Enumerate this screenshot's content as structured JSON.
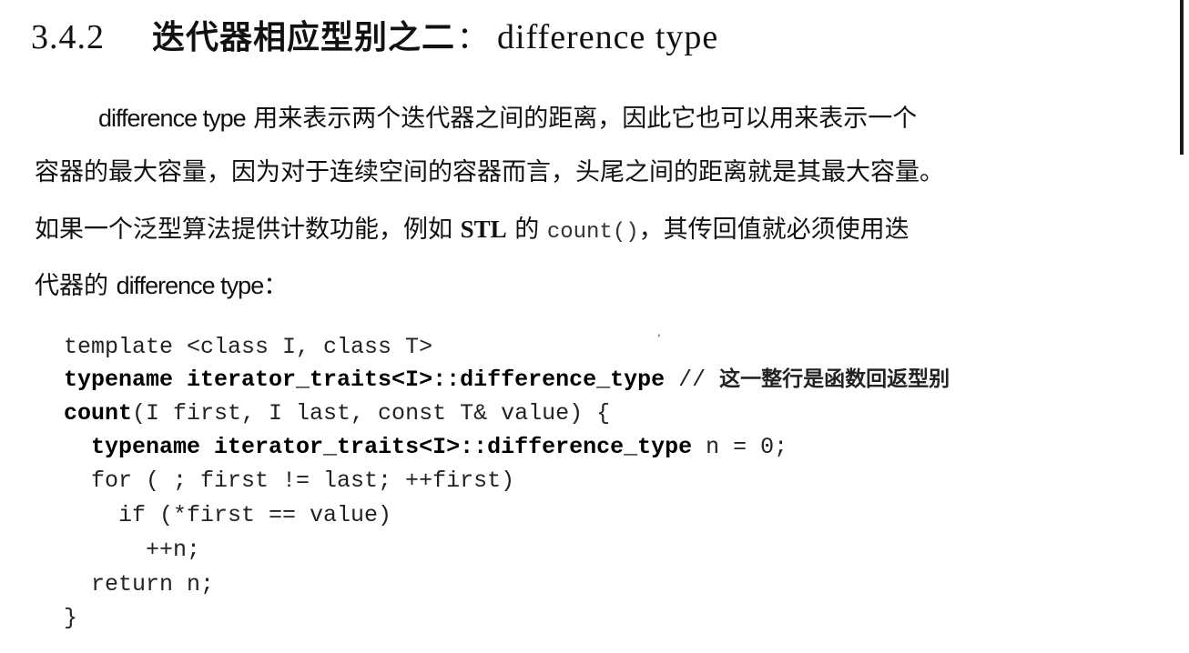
{
  "section": {
    "number": "3.4.2",
    "title_cn": "迭代器相应型别之二",
    "separator": "：",
    "title_en": "difference type"
  },
  "paragraph": {
    "line1": {
      "en_term": "difference type",
      "text": " 用来表示两个迭代器之间的距离，因此它也可以用来表示一个"
    },
    "line2": "容器的最大容量，因为对于连续空间的容器而言，头尾之间的距离就是其最大容量。",
    "line3": {
      "part1": "如果一个泛型算法提供计数功能，例如 ",
      "stl": "STL",
      "part2": " 的 ",
      "code": "count()",
      "part3": "，其传回值就必须使用迭"
    },
    "line4": {
      "part1": "代器的 ",
      "en_term": "difference type",
      "part2": "："
    }
  },
  "code": {
    "line1": "template <class I, class T>",
    "line2_kw": "typename iterator_traits<I>::difference_type",
    "line2_comment": " // ",
    "line2_comment_cn": "这一整行是函数回返型别",
    "line3_kw": "count",
    "line3_rest": "(I first, I last, const T& value) {",
    "line4_indent": "  ",
    "line4_kw": "typename iterator_traits<I>::difference_type",
    "line4_rest": " n = 0;",
    "line5": "  for ( ; first != last; ++first)",
    "line6": "    if (*first == value)",
    "line7": "      ++n;",
    "line8": "  return n;",
    "line9": "}"
  }
}
